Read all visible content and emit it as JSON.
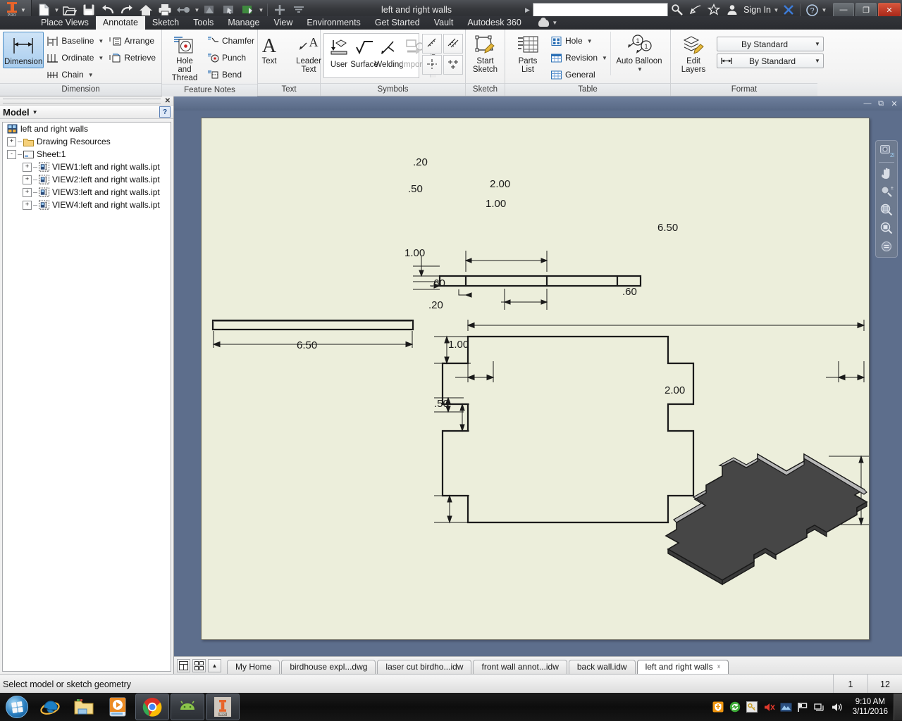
{
  "titlebar": {
    "document_title": "left and right walls",
    "search_placeholder": "",
    "sign_in_label": "Sign In",
    "quick_access": [
      {
        "name": "new-icon",
        "label": "New"
      },
      {
        "name": "open-icon",
        "label": "Open"
      },
      {
        "name": "save-icon",
        "label": "Save"
      },
      {
        "name": "undo-icon",
        "label": "Undo"
      },
      {
        "name": "redo-icon",
        "label": "Redo"
      },
      {
        "name": "home-icon",
        "label": "Home"
      },
      {
        "name": "print-icon",
        "label": "Print"
      },
      {
        "name": "return-icon",
        "label": "Return"
      },
      {
        "name": "update-icon",
        "label": "Update"
      },
      {
        "name": "select-icon",
        "label": "Select"
      },
      {
        "name": "material-icon",
        "label": "Material"
      },
      {
        "name": "add-icon",
        "label": "Customize"
      },
      {
        "name": "more-icon",
        "label": "More"
      }
    ],
    "window_buttons": {
      "minimize": "—",
      "restore": "❐",
      "close": "✕"
    }
  },
  "ribbon": {
    "tabs": [
      {
        "label": "Place Views",
        "active": false
      },
      {
        "label": "Annotate",
        "active": true
      },
      {
        "label": "Sketch",
        "active": false
      },
      {
        "label": "Tools",
        "active": false
      },
      {
        "label": "Manage",
        "active": false
      },
      {
        "label": "View",
        "active": false
      },
      {
        "label": "Environments",
        "active": false
      },
      {
        "label": "Get Started",
        "active": false
      },
      {
        "label": "Vault",
        "active": false
      },
      {
        "label": "Autodesk 360",
        "active": false
      }
    ],
    "panels": [
      {
        "title": "Dimension",
        "big": [
          {
            "label": "Dimension",
            "icon": "dimension-icon",
            "selected": true
          }
        ],
        "small_col1": [
          {
            "label": "Baseline",
            "icon": "baseline-icon",
            "dropdown": true
          },
          {
            "label": "Ordinate",
            "icon": "ordinate-icon",
            "dropdown": true
          },
          {
            "label": "Chain",
            "icon": "chain-icon",
            "dropdown": true
          }
        ],
        "small_col2": [
          {
            "label": "Arrange",
            "icon": "arrange-icon",
            "dropdown": false
          },
          {
            "label": "Retrieve",
            "icon": "retrieve-icon",
            "dropdown": false
          }
        ]
      },
      {
        "title": "Feature Notes",
        "big": [
          {
            "label": "Hole and\nThread",
            "icon": "hole-thread-icon",
            "selected": false
          }
        ],
        "small_col1": [
          {
            "label": "Chamfer",
            "icon": "chamfer-icon",
            "dropdown": false
          },
          {
            "label": "Punch",
            "icon": "punch-icon",
            "dropdown": false
          },
          {
            "label": "Bend",
            "icon": "bend-icon",
            "dropdown": false
          }
        ]
      },
      {
        "title": "Text",
        "big": [
          {
            "label": "Text",
            "icon": "text-icon",
            "selected": false
          },
          {
            "label": "Leader\nText",
            "icon": "leader-text-icon",
            "selected": false
          }
        ]
      },
      {
        "title": "Symbols",
        "gallery": [
          {
            "label": "User",
            "icon": "user-symbol-icon",
            "disabled": false
          },
          {
            "label": "Surface",
            "icon": "surface-symbol-icon",
            "disabled": false
          },
          {
            "label": "Welding",
            "icon": "welding-symbol-icon",
            "disabled": false
          },
          {
            "label": "Impor...",
            "icon": "import-symbol-icon",
            "disabled": true
          }
        ],
        "grid": [
          {
            "icon": "caterpillar-icon"
          },
          {
            "icon": "end-fill-icon"
          },
          {
            "icon": "center-mark-icon"
          },
          {
            "icon": "centered-pattern-icon"
          }
        ]
      },
      {
        "title": "Sketch",
        "big": [
          {
            "label": "Start\nSketch",
            "icon": "start-sketch-icon",
            "selected": false
          }
        ]
      },
      {
        "title": "Table",
        "big": [
          {
            "label": "Parts\nList",
            "icon": "parts-list-icon",
            "selected": false
          }
        ],
        "small_col1": [
          {
            "label": "Hole",
            "icon": "hole-table-icon",
            "dropdown": true
          },
          {
            "label": "Revision",
            "icon": "revision-table-icon",
            "dropdown": true
          },
          {
            "label": "General",
            "icon": "general-table-icon",
            "dropdown": false
          }
        ],
        "big2": [
          {
            "label": "Auto Balloon",
            "icon": "auto-balloon-icon",
            "dropdown": true
          }
        ]
      },
      {
        "title": "Format",
        "big": [
          {
            "label": "Edit\nLayers",
            "icon": "edit-layers-icon",
            "selected": false
          }
        ],
        "combos": [
          {
            "value": "By Standard",
            "icon": null,
            "name": "layer-style-combo"
          },
          {
            "value": "By Standard",
            "icon": "dimension-style-icon",
            "name": "dimension-style-combo"
          }
        ]
      }
    ]
  },
  "browser": {
    "panel_title": "Model",
    "close_label": "✕",
    "help_label": "?",
    "tree": [
      {
        "label": "left and right walls",
        "depth": 0,
        "expander": "none",
        "icon": "drawing-doc-icon"
      },
      {
        "label": "Drawing Resources",
        "depth": 1,
        "expander": "+",
        "icon": "folder-icon"
      },
      {
        "label": "Sheet:1",
        "depth": 1,
        "expander": "-",
        "icon": "sheet-icon"
      },
      {
        "label": "VIEW1:left and right walls.ipt",
        "depth": 2,
        "expander": "+",
        "icon": "view-icon"
      },
      {
        "label": "VIEW2:left and right walls.ipt",
        "depth": 2,
        "expander": "+",
        "icon": "view-icon"
      },
      {
        "label": "VIEW3:left and right walls.ipt",
        "depth": 2,
        "expander": "+",
        "icon": "view-icon"
      },
      {
        "label": "VIEW4:left and right walls.ipt",
        "depth": 2,
        "expander": "+",
        "icon": "view-icon"
      }
    ]
  },
  "drawing": {
    "sheet_color": "#eceedb",
    "line_color": "#1a1a1a",
    "solid_fill": "#464646",
    "solid_edge": "#b8b8b8",
    "dimensions": {
      "top_view": [
        {
          "value": ".20",
          "kind": "vertical-thickness"
        },
        {
          "value": ".50",
          "kind": "horizontal-offset"
        },
        {
          "value": "2.00",
          "kind": "horizontal-span"
        },
        {
          "value": "1.00",
          "kind": "horizontal-span"
        }
      ],
      "front_view": [
        {
          "value": "6.50",
          "kind": "overall-width"
        },
        {
          "value": "1.00",
          "kind": "top-left-notch-height"
        },
        {
          "value": ".60",
          "kind": "left-notch-depth"
        },
        {
          "value": ".60",
          "kind": "right-notch-depth"
        },
        {
          "value": ".20",
          "kind": "gap"
        },
        {
          "value": "1.00",
          "kind": "middle-notch-height"
        },
        {
          "value": "2.00",
          "kind": "right-lower-notch-height"
        },
        {
          "value": ".50",
          "kind": "bottom-notch-height"
        }
      ],
      "side_view": [
        {
          "value": "6.50",
          "kind": "overall-length"
        }
      ]
    }
  },
  "doctabs": {
    "nav_buttons": [
      {
        "name": "tile-horizontal-button"
      },
      {
        "name": "tile-grid-button"
      },
      {
        "name": "scroll-up-button"
      }
    ],
    "tabs": [
      {
        "label": "My Home",
        "active": false,
        "closable": false
      },
      {
        "label": "birdhouse expl...dwg",
        "active": false,
        "closable": false
      },
      {
        "label": "laser cut birdho...idw",
        "active": false,
        "closable": false
      },
      {
        "label": "front wall annot...idw",
        "active": false,
        "closable": false
      },
      {
        "label": "back wall.idw",
        "active": false,
        "closable": false
      },
      {
        "label": "left and right walls",
        "active": true,
        "closable": true
      }
    ]
  },
  "statusbar": {
    "message": "Select model or sketch geometry",
    "fields": [
      "1",
      "12"
    ]
  },
  "taskbar": {
    "apps": [
      {
        "name": "internet-explorer-icon",
        "running": false
      },
      {
        "name": "file-explorer-icon",
        "running": false
      },
      {
        "name": "media-player-icon",
        "running": false
      },
      {
        "name": "google-chrome-icon",
        "running": true
      },
      {
        "name": "android-studio-icon",
        "running": true
      },
      {
        "name": "inventor-icon",
        "running": true
      }
    ],
    "tray": [
      {
        "name": "security-shield-icon"
      },
      {
        "name": "sync-icon"
      },
      {
        "name": "key-icon"
      },
      {
        "name": "volume-muted-icon"
      },
      {
        "name": "graphics-icon"
      },
      {
        "name": "flag-icon"
      },
      {
        "name": "network-icon"
      },
      {
        "name": "speaker-icon"
      }
    ],
    "clock": {
      "time": "9:10 AM",
      "date": "3/11/2016"
    }
  }
}
